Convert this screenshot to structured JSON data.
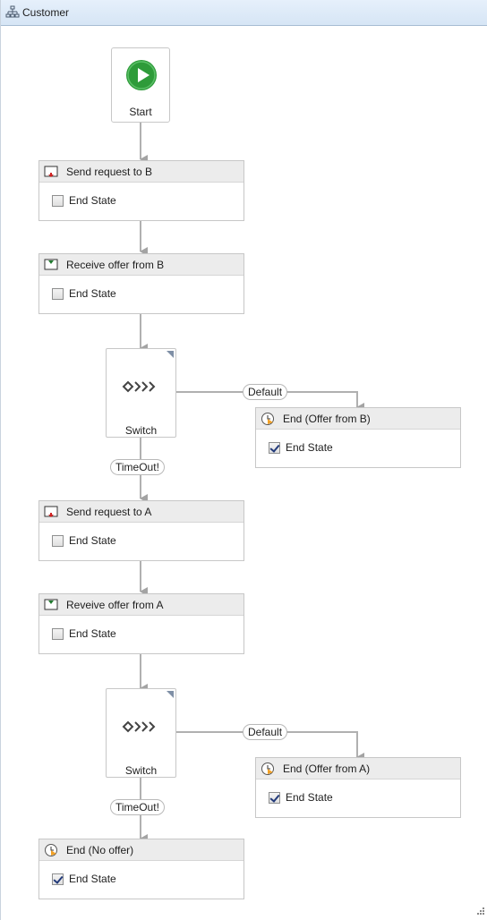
{
  "window": {
    "title": "Customer",
    "icon": "flowchart-icon"
  },
  "start": {
    "label": "Start",
    "icon": "play-circle-icon",
    "color": "#2e9b3a"
  },
  "activities": {
    "send_b": {
      "title": "Send request to B",
      "icon": "send-icon",
      "end_state_label": "End State",
      "end_state_checked": false
    },
    "recv_b": {
      "title": "Receive offer from B",
      "icon": "receive-icon",
      "end_state_label": "End State",
      "end_state_checked": false
    },
    "end_b": {
      "title": "End (Offer from B)",
      "icon": "clock-end-icon",
      "end_state_label": "End State",
      "end_state_checked": true
    },
    "send_a": {
      "title": "Send request to A",
      "icon": "send-icon",
      "end_state_label": "End State",
      "end_state_checked": false
    },
    "recv_a": {
      "title": "Reveive offer from A",
      "icon": "receive-icon",
      "end_state_label": "End State",
      "end_state_checked": false
    },
    "end_a": {
      "title": "End (Offer from A)",
      "icon": "clock-end-icon",
      "end_state_label": "End State",
      "end_state_checked": true
    },
    "end_none": {
      "title": "End (No offer)",
      "icon": "clock-end-icon",
      "end_state_label": "End State",
      "end_state_checked": true
    }
  },
  "switches": {
    "sw1": {
      "label": "Switch",
      "icon": "switch-icon",
      "default_label": "Default",
      "case_label": "TimeOut!"
    },
    "sw2": {
      "label": "Switch",
      "icon": "switch-icon",
      "default_label": "Default",
      "case_label": "TimeOut!"
    }
  }
}
